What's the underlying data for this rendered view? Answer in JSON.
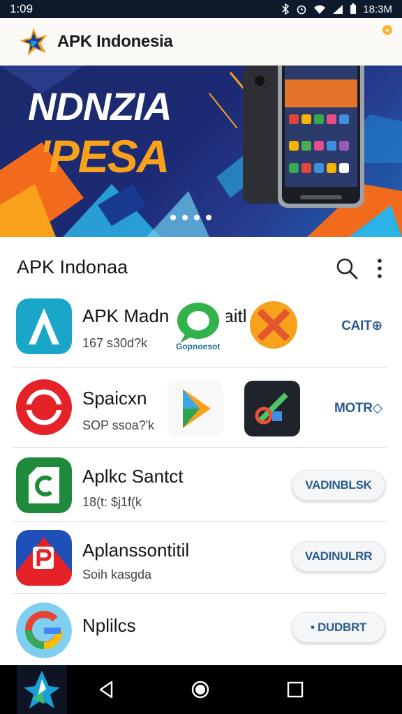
{
  "status_bar": {
    "time": "1:09",
    "right_time": "18:3M",
    "icons": [
      "bluetooth-icon",
      "alarm-icon",
      "wifi-icon",
      "signal-icon",
      "battery-icon"
    ]
  },
  "app_header": {
    "title": "APK Indonesia",
    "logo_icon": "apk-indonesia-logo"
  },
  "banner": {
    "headline": "NDNZIA",
    "subline": "'PESA",
    "slides": 4,
    "active_slide": 1,
    "colors": {
      "bg": "#1c2a74",
      "accent_orange": "#f9a11b",
      "accent_cyan": "#20a8e0"
    }
  },
  "section": {
    "title": "APK Indonaa",
    "icons": [
      "search-icon",
      "more-vert-icon"
    ]
  },
  "apps": [
    {
      "name": "APK Madnrkesnnaitka",
      "meta": "167 s30d?k",
      "action": "CAIT⊕",
      "icon": "teal-a-icon",
      "thumbs": [
        {
          "icon": "chat-bubble-icon",
          "caption": "Gopnoesot"
        },
        {
          "icon": "orange-x-icon",
          "caption": ""
        }
      ]
    },
    {
      "name": "Spaicxn",
      "meta": "SOP ssoa?'k",
      "action": "MOTR◇",
      "icon": "red-ring-icon",
      "thumbs": [
        {
          "icon": "play-store-icon",
          "caption": ""
        },
        {
          "icon": "tools-icon",
          "caption": ""
        }
      ]
    },
    {
      "name": "Aplkc Santct",
      "meta": "18(t: $j1f(k",
      "action": "VADINBLSK",
      "icon": "green-c-icon",
      "thumbs": []
    },
    {
      "name": "Aplanssontitil",
      "meta": "Soih kasgda",
      "action": "VADINULRR",
      "icon": "red-p-icon",
      "thumbs": []
    },
    {
      "name": "Nplilcs",
      "meta": "",
      "action": "• DUDBRT",
      "icon": "google-g-icon",
      "thumbs": []
    }
  ],
  "nav_bar": {
    "buttons": [
      "back-icon",
      "home-icon",
      "recents-icon"
    ]
  }
}
